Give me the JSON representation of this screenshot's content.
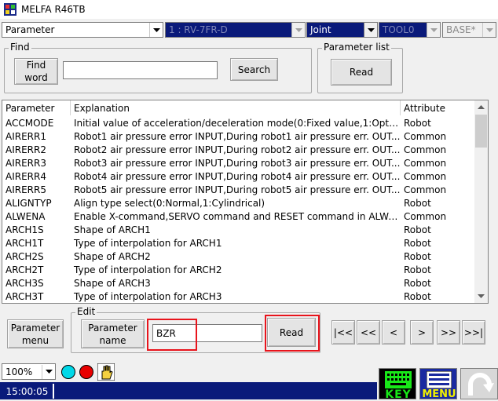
{
  "window": {
    "title": "MELFA R46TB"
  },
  "toolbar": {
    "mode_select": "Parameter",
    "robot_select": "1 : RV-7FR-D",
    "jog_select": "Joint",
    "tool_select": "TOOL0",
    "base_select": "BASE*"
  },
  "find": {
    "group_label": "Find",
    "find_word_button": "Find\nword",
    "find_input_value": "",
    "search_button": "Search"
  },
  "param_list": {
    "group_label": "Parameter list",
    "read_button": "Read"
  },
  "table": {
    "headers": [
      "Parameter",
      "Explanation",
      "Attribute"
    ],
    "rows": [
      [
        "ACCMODE",
        "Initial value of acceleration/deceleration mode(0:Fixed value,1:Optim...",
        "Robot"
      ],
      [
        "AIRERR1",
        "Robot1 air pressure error INPUT,During robot1 air pressure err. OUT...",
        "Common"
      ],
      [
        "AIRERR2",
        "Robot2 air pressure error INPUT,During robot2 air pressure err. OUT...",
        "Common"
      ],
      [
        "AIRERR3",
        "Robot3 air pressure error INPUT,During robot3 air pressure err. OUT...",
        "Common"
      ],
      [
        "AIRERR4",
        "Robot4 air pressure error INPUT,During robot4 air pressure err. OUT...",
        "Common"
      ],
      [
        "AIRERR5",
        "Robot5 air pressure error INPUT,During robot5 air pressure err. OUT...",
        "Common"
      ],
      [
        "ALIGNTYP",
        "Align type select(0:Normal,1:Cylindrical)",
        "Robot"
      ],
      [
        "ALWENA",
        "Enable X-command,SERVO command and RESET command in ALWA...",
        "Common"
      ],
      [
        "ARCH1S",
        "Shape of ARCH1",
        "Robot"
      ],
      [
        "ARCH1T",
        "Type of interpolation for ARCH1",
        "Robot"
      ],
      [
        "ARCH2S",
        "Shape of ARCH2",
        "Robot"
      ],
      [
        "ARCH2T",
        "Type of interpolation for ARCH2",
        "Robot"
      ],
      [
        "ARCH3S",
        "Shape of ARCH3",
        "Robot"
      ],
      [
        "ARCH3T",
        "Type of interpolation for ARCH3",
        "Robot"
      ]
    ]
  },
  "edit": {
    "group_label": "Edit",
    "param_menu_button": "Parameter\nmenu",
    "param_name_button": "Parameter\nname",
    "param_name_value": "BZR",
    "read_button": "Read"
  },
  "nav": {
    "first": "|<<",
    "prev_page": "<<",
    "prev": "<",
    "next": ">",
    "next_page": ">>",
    "last": ">>|"
  },
  "bottom": {
    "speed_select": "100%",
    "clock": "15:00:05",
    "key_label": "KEY",
    "menu_label": "MENU"
  },
  "colors": {
    "dark_blue": "#0a1a7a",
    "highlight_red": "#e8141c",
    "cyan_indicator": "#00d8e8",
    "red_indicator": "#e80000",
    "key_green": "#18e818",
    "menu_yellow": "#f0f000"
  }
}
